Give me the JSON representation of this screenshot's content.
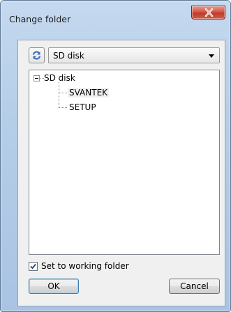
{
  "window": {
    "title": "Change folder"
  },
  "toolbar": {
    "refresh_icon": "refresh-icon",
    "drive_selected": "SD disk"
  },
  "tree": {
    "root": "SD disk",
    "children": [
      "SVANTEK",
      "SETUP"
    ]
  },
  "options": {
    "working_folder_label": "Set to working folder",
    "working_folder_checked": true
  },
  "buttons": {
    "ok": "OK",
    "cancel": "Cancel"
  },
  "colors": {
    "close_button": "#c13a2b",
    "frame": "#b4cde8",
    "refresh_icon": "#3a6fc4"
  }
}
